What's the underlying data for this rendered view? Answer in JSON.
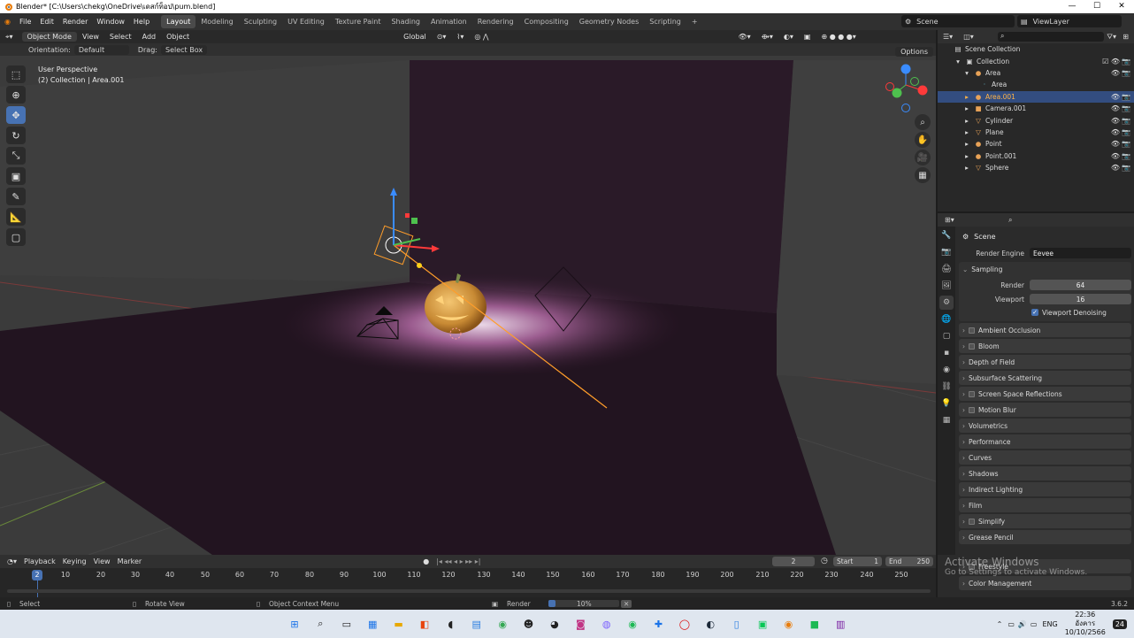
{
  "window": {
    "title": "Blender* [C:\\Users\\chekg\\OneDrive\\เดสก์ท็อป\\pum.blend]",
    "min_label": "—",
    "max_label": "☐",
    "close_label": "✕"
  },
  "menu": [
    "File",
    "Edit",
    "Render",
    "Window",
    "Help"
  ],
  "workspaces": [
    {
      "label": "Layout",
      "active": true
    },
    {
      "label": "Modeling"
    },
    {
      "label": "Sculpting"
    },
    {
      "label": "UV Editing"
    },
    {
      "label": "Texture Paint"
    },
    {
      "label": "Shading"
    },
    {
      "label": "Animation"
    },
    {
      "label": "Rendering"
    },
    {
      "label": "Compositing"
    },
    {
      "label": "Geometry Nodes"
    },
    {
      "label": "Scripting"
    },
    {
      "label": "+"
    }
  ],
  "scene_selector": "Scene",
  "viewlayer_selector": "ViewLayer",
  "viewport": {
    "mode": "Object Mode",
    "menus": [
      "View",
      "Select",
      "Add",
      "Object"
    ],
    "transform_orientation": "Global",
    "orientation_label": "Orientation:",
    "orientation_value": "Default",
    "drag_label": "Drag:",
    "drag_value": "Select Box",
    "options_label": "Options",
    "overlay_line1": "User Perspective",
    "overlay_line2": "(2) Collection | Area.001"
  },
  "outliner": {
    "root": "Scene Collection",
    "rows": [
      {
        "label": "Collection",
        "indent": 1,
        "icon": "▣"
      },
      {
        "label": "Area",
        "indent": 2,
        "icon": "●"
      },
      {
        "label": "Area",
        "indent": 3,
        "icon": "·"
      },
      {
        "label": "Area.001",
        "indent": 2,
        "icon": "●",
        "selected": true
      },
      {
        "label": "Camera.001",
        "indent": 2,
        "icon": "■"
      },
      {
        "label": "Cylinder",
        "indent": 2,
        "icon": "▽"
      },
      {
        "label": "Plane",
        "indent": 2,
        "icon": "▽"
      },
      {
        "label": "Point",
        "indent": 2,
        "icon": "●"
      },
      {
        "label": "Point.001",
        "indent": 2,
        "icon": "●"
      },
      {
        "label": "Sphere",
        "indent": 2,
        "icon": "▽"
      }
    ]
  },
  "properties": {
    "scene_name": "Scene",
    "render_engine_label": "Render Engine",
    "render_engine_value": "Eevee",
    "sampling_label": "Sampling",
    "render_label": "Render",
    "render_value": "64",
    "viewport_label": "Viewport",
    "viewport_value": "16",
    "denoise_label": "Viewport Denoising",
    "panels": [
      {
        "label": "Ambient Occlusion",
        "checkbox": true
      },
      {
        "label": "Bloom",
        "checkbox": true
      },
      {
        "label": "Depth of Field"
      },
      {
        "label": "Subsurface Scattering"
      },
      {
        "label": "Screen Space Reflections",
        "checkbox": true
      },
      {
        "label": "Motion Blur",
        "checkbox": true
      },
      {
        "label": "Volumetrics"
      },
      {
        "label": "Performance"
      },
      {
        "label": "Curves"
      },
      {
        "label": "Shadows"
      },
      {
        "label": "Indirect Lighting"
      },
      {
        "label": "Film"
      },
      {
        "label": "Simplify",
        "checkbox": true
      },
      {
        "label": "Grease Pencil"
      },
      {
        "label": "Freestyle",
        "checkbox": true
      },
      {
        "label": "Color Management"
      }
    ]
  },
  "timeline": {
    "menus": [
      "Playback",
      "Keying",
      "View",
      "Marker"
    ],
    "current_frame": "2",
    "start_label": "Start",
    "start_value": "1",
    "end_label": "End",
    "end_value": "250",
    "ticks": [
      "10",
      "20",
      "30",
      "40",
      "50",
      "60",
      "70",
      "80",
      "90",
      "100",
      "110",
      "120",
      "130",
      "140",
      "150",
      "160",
      "170",
      "180",
      "190",
      "200",
      "210",
      "220",
      "230",
      "240",
      "250"
    ]
  },
  "statusbar": {
    "select": "Select",
    "rotate": "Rotate View",
    "context": "Object Context Menu",
    "render": "Render",
    "progress": "10%",
    "progress_fraction": 0.1,
    "version": "3.6.2"
  },
  "watermark": {
    "line1": "Activate Windows",
    "line2": "Go to Settings to activate Windows."
  },
  "tray": {
    "lang": "ENG",
    "time": "22:36",
    "day": "อังคาร",
    "date": "10/10/2566",
    "notif": "24"
  },
  "colors": {
    "accent": "#4772b3",
    "selection_text": "#ffb347",
    "viewport_bg": "#3a3a3a"
  }
}
